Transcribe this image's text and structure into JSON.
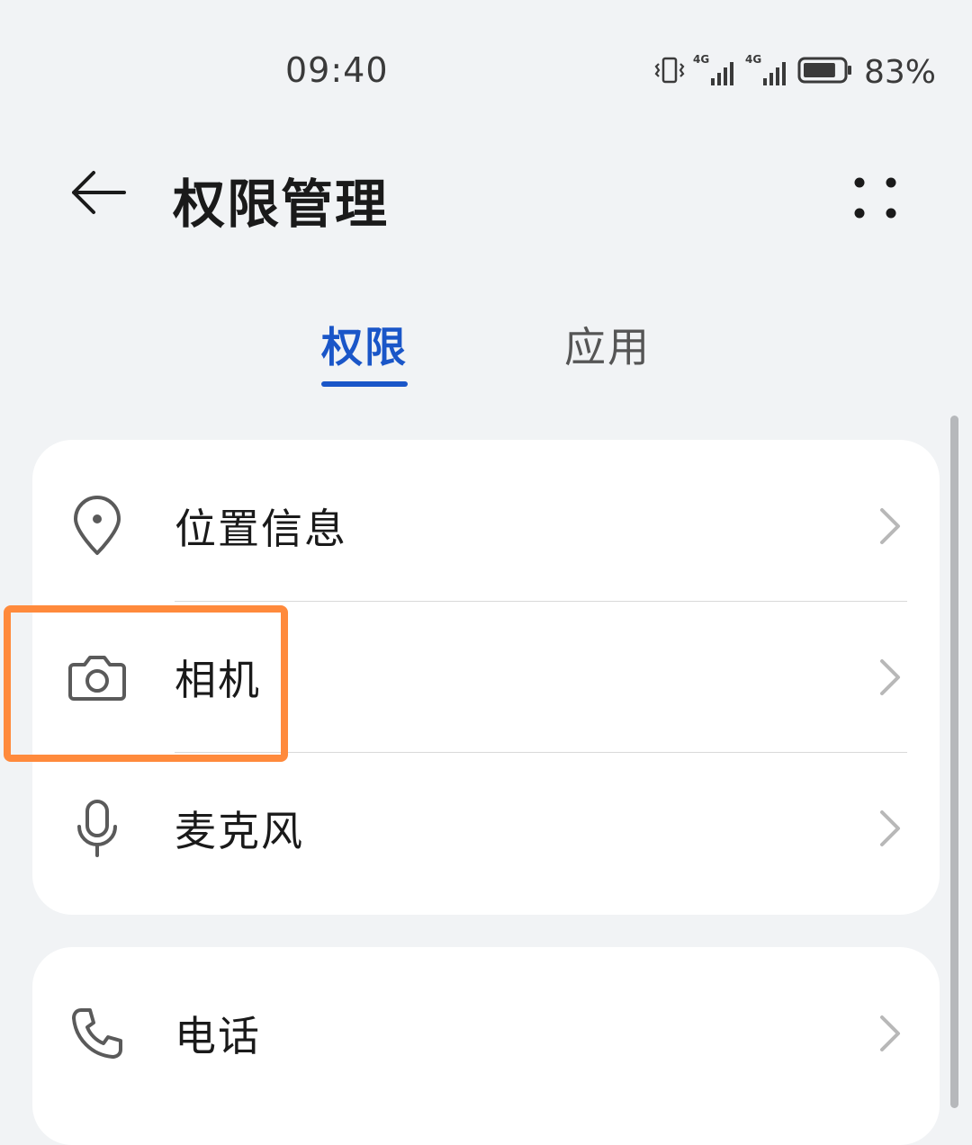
{
  "status_bar": {
    "time": "09:40",
    "signal_1_label": "4G",
    "signal_2_label": "4G",
    "battery": "83%",
    "battery_level": 0.83
  },
  "app_bar": {
    "title": "权限管理",
    "back_icon": "arrow-left-icon",
    "more_icon": "more-dots-icon"
  },
  "tabs": [
    {
      "label": "权限",
      "selected": true
    },
    {
      "label": "应用",
      "selected": false
    }
  ],
  "colors": {
    "accent": "#1a56c8",
    "highlight": "#ff8a3c",
    "background": "#f1f3f5"
  },
  "permission_groups": [
    {
      "items": [
        {
          "label": "位置信息",
          "icon": "location-pin-icon"
        },
        {
          "label": "相机",
          "icon": "camera-icon"
        },
        {
          "label": "麦克风",
          "icon": "microphone-icon"
        }
      ]
    },
    {
      "items": [
        {
          "label": "电话",
          "icon": "phone-icon"
        }
      ]
    }
  ]
}
